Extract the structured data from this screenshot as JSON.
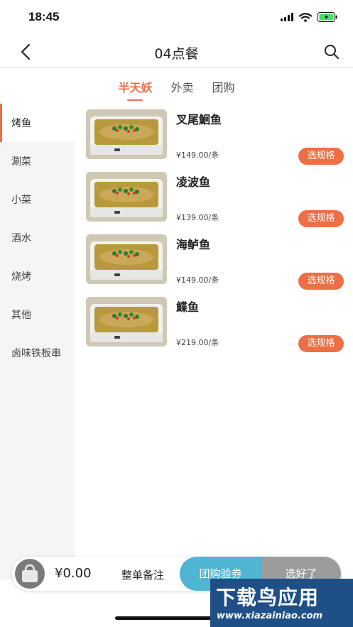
{
  "status_bar": {
    "time": "18:45"
  },
  "nav": {
    "title": "04点餐"
  },
  "tabs": [
    {
      "label": "半天妖",
      "active": true
    },
    {
      "label": "外卖",
      "active": false
    },
    {
      "label": "团购",
      "active": false
    }
  ],
  "categories": [
    {
      "label": "烤鱼",
      "active": true
    },
    {
      "label": "涮菜",
      "active": false
    },
    {
      "label": "小菜",
      "active": false
    },
    {
      "label": "酒水",
      "active": false
    },
    {
      "label": "烧烤",
      "active": false
    },
    {
      "label": "其他",
      "active": false
    },
    {
      "label": "卤味铁板串",
      "active": false
    }
  ],
  "products": [
    {
      "name": "叉尾鮰鱼",
      "price": "¥149.00/条",
      "spec_label": "选规格"
    },
    {
      "name": "凌波鱼",
      "price": "¥139.00/条",
      "spec_label": "选规格"
    },
    {
      "name": "海鲈鱼",
      "price": "¥149.00/条",
      "spec_label": "选规格"
    },
    {
      "name": "鲽鱼",
      "price": "¥219.00/条",
      "spec_label": "选规格"
    }
  ],
  "cart": {
    "total": "¥0.00",
    "note_label": "整单备注",
    "coupon_label": "团购验券",
    "done_label": "选好了"
  },
  "watermark": {
    "title": "下载鸟应用",
    "url": "www.xiazainiao.com"
  },
  "colors": {
    "accent": "#ec6f45",
    "coupon": "#4fb5d2",
    "done": "#9c9c9c",
    "sidebar_bg": "#f5f5f5"
  },
  "icons": [
    "back-icon",
    "search-icon",
    "signal-icon",
    "wifi-icon",
    "battery-icon",
    "shopping-bag-icon"
  ]
}
